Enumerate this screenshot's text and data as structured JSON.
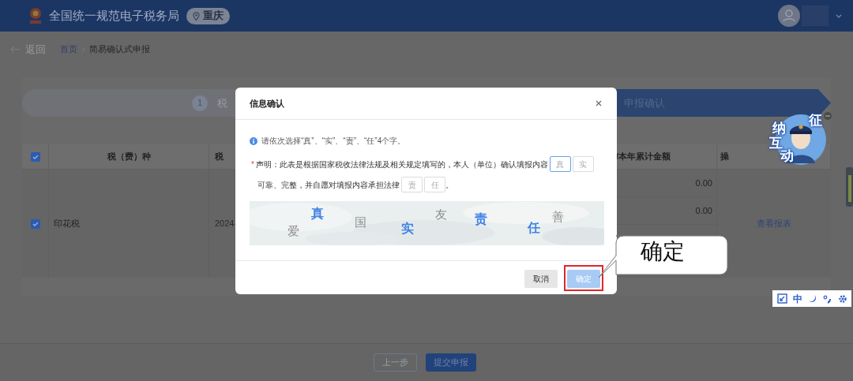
{
  "header": {
    "title": "全国统一规范电子税务局",
    "region": "重庆"
  },
  "breadcrumb": {
    "back": "返回",
    "items": [
      {
        "label": "首页",
        "kind": "link"
      },
      {
        "label": "简易确认式申报",
        "kind": "current"
      }
    ]
  },
  "steps": [
    {
      "number": "1",
      "label": "税",
      "selected": false
    },
    {
      "label": "申报确认",
      "selected": true
    }
  ],
  "table": {
    "header_checked": true,
    "columns": [
      {
        "label": "税（费）种"
      },
      {
        "label": "税"
      },
      {
        "label": "/本年累计金额"
      },
      {
        "label": "操"
      }
    ],
    "rows": [
      {
        "checked": true,
        "tax_type": "印花税",
        "period": "2024-",
        "amounts": [
          "0.00",
          "0.00"
        ],
        "action": "查看报表"
      }
    ]
  },
  "footer_buttons": [
    {
      "label": "上一步",
      "kind": "secondary"
    },
    {
      "label": "提交申报",
      "kind": "primary"
    }
  ],
  "dialog": {
    "title": "信息确认",
    "hint": "请依次选择“真”、“实”、“责”、“任”4个字。",
    "required_mark": "*",
    "parts": [
      {
        "kind": "text",
        "text": "声明：此表是根据国家税收法律法规及相关规定填写的，本人（单位）确认填报内容"
      },
      {
        "kind": "input",
        "placeholder": "真",
        "focused": true
      },
      {
        "kind": "input",
        "placeholder": "实",
        "focused": false
      },
      {
        "kind": "break"
      },
      {
        "kind": "text",
        "text": "可靠、完整，并自愿对填报内容承担法律"
      },
      {
        "kind": "input",
        "placeholder": "责",
        "focused": false
      },
      {
        "kind": "input",
        "placeholder": "任",
        "focused": false
      },
      {
        "kind": "text",
        "text": "。"
      }
    ],
    "captcha": [
      {
        "char": "爱",
        "kind": "decoy"
      },
      {
        "char": "真",
        "kind": "answer"
      },
      {
        "char": "国",
        "kind": "decoy"
      },
      {
        "char": "实",
        "kind": "answer"
      },
      {
        "char": "友",
        "kind": "decoy"
      },
      {
        "char": "责",
        "kind": "answer"
      },
      {
        "char": "任",
        "kind": "answer"
      },
      {
        "char": "善",
        "kind": "decoy"
      }
    ],
    "buttons": [
      {
        "label": "取消",
        "kind": "cancel",
        "highlighted": false
      },
      {
        "label": "确定",
        "kind": "confirm",
        "highlighted": true
      }
    ]
  },
  "callout": {
    "text": "确定"
  },
  "mascot": {
    "chars": [
      "征",
      "纳",
      "互",
      "动"
    ]
  },
  "toolbar": {
    "language": "中"
  }
}
